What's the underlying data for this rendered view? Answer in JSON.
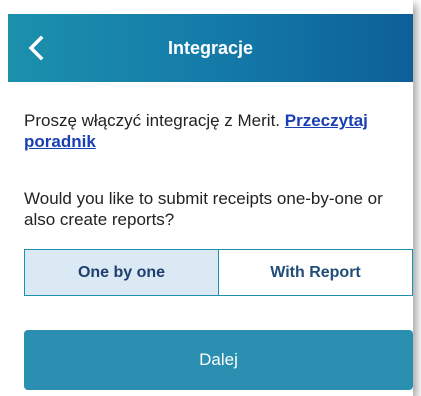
{
  "header": {
    "back_icon": "chevron-left-icon",
    "title": "Integracje"
  },
  "intro": {
    "text": "Proszę włączyć integrację z Merit. ",
    "link_label": "Przeczytaj poradnik"
  },
  "question": {
    "text": "Would you like to submit receipts one-by-one or also create reports?"
  },
  "mode_selector": {
    "options": [
      {
        "label": "One by one",
        "selected": true
      },
      {
        "label": "With Report",
        "selected": false
      }
    ]
  },
  "next_button": {
    "label": "Dalej"
  },
  "colors": {
    "header_gradient_start": "#1c90ad",
    "header_gradient_end": "#0d5f98",
    "primary_button": "#2a8fb0",
    "link": "#1a3fb5",
    "segment_selected_bg": "#dbe9f4"
  }
}
